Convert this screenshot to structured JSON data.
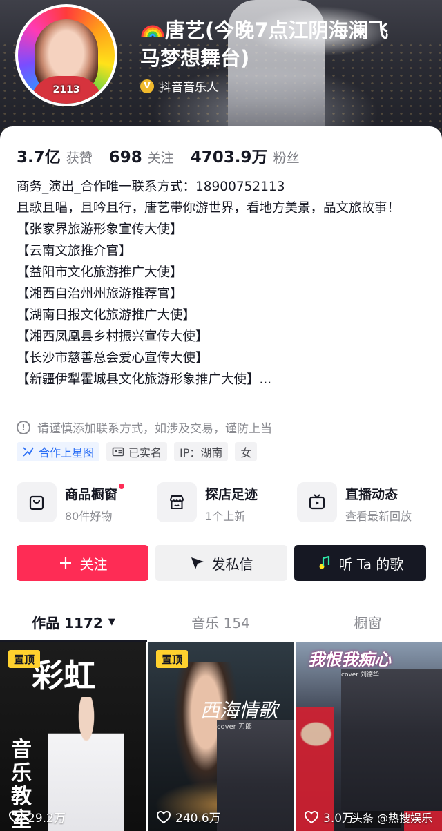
{
  "profile": {
    "display_name": "唐艺(今晚7点江阴海澜飞马梦想舞台)",
    "name_line1": "唐艺(今晚7点江阴海澜飞",
    "name_line2": "马梦想舞台)",
    "name_emoji": "rainbow-icon",
    "verified_label": "抖音音乐人",
    "verified_icon": "verified-v-icon",
    "verified_color": "#f0b92c",
    "avatar_number": "2113"
  },
  "stats": [
    {
      "value": "3.7亿",
      "label": "获赞"
    },
    {
      "value": "698",
      "label": "关注"
    },
    {
      "value": "4703.9万",
      "label": "粉丝"
    }
  ],
  "bio": {
    "lines": [
      "商务_演出_合作唯一联系方式：18900752113",
      "且歌且唱，且吟且行，唐艺带你游世界，看地方美景，品文旅故事！",
      "【张家界旅游形象宣传大使】",
      "【云南文旅推介官】",
      "【益阳市文化旅游推广大使】",
      "【湘西自治州州旅游推荐官】",
      "【湖南日报文化旅游推广大使】",
      "【湘西凤凰县乡村振兴宣传大使】",
      "【长沙市慈善总会爱心宣传大使】",
      "【新疆伊犁霍城县文化旅游形象推广大使】..."
    ]
  },
  "warning": {
    "icon": "exclamation-circle-icon",
    "text": "请谨慎添加联系方式，如涉及交易，谨防上当"
  },
  "tags": [
    {
      "label": "合作上星图",
      "icon": "star-map-icon",
      "color": "#2a6ef5"
    },
    {
      "label": "已实名",
      "icon": "id-card-icon"
    },
    {
      "label": "IP：湖南"
    },
    {
      "label": "女"
    }
  ],
  "shortcuts": [
    {
      "title": "商品橱窗",
      "subtitle": "80件好物",
      "icon": "shopping-bag-icon",
      "has_dot": true
    },
    {
      "title": "探店足迹",
      "subtitle": "1个上新",
      "icon": "store-icon"
    },
    {
      "title": "直播动态",
      "subtitle": "查看最新回放",
      "icon": "tv-icon"
    }
  ],
  "actions": {
    "follow_label": "关注",
    "message_label": "发私信",
    "song_label": "听 Ta 的歌",
    "follow_color": "#fe2c55",
    "song_color": "#161823"
  },
  "tabs": [
    {
      "label": "作品 1172",
      "active": true
    },
    {
      "label": "音乐 154",
      "active": false
    },
    {
      "label": "橱窗",
      "active": false
    }
  ],
  "videos": [
    {
      "pin_label": "置顶",
      "likes": "29.2万",
      "cover_big": "彩虹",
      "cover_small": "音乐教室"
    },
    {
      "pin_label": "置顶",
      "likes": "240.6万",
      "cover_title": "西海情歌",
      "cover_sub": "cover 刀郎"
    },
    {
      "likes": "3.0万",
      "cover_title": "我恨我痴心",
      "cover_sub": "cover 刘德华"
    }
  ],
  "watermark": "头条 @热搜娱乐"
}
